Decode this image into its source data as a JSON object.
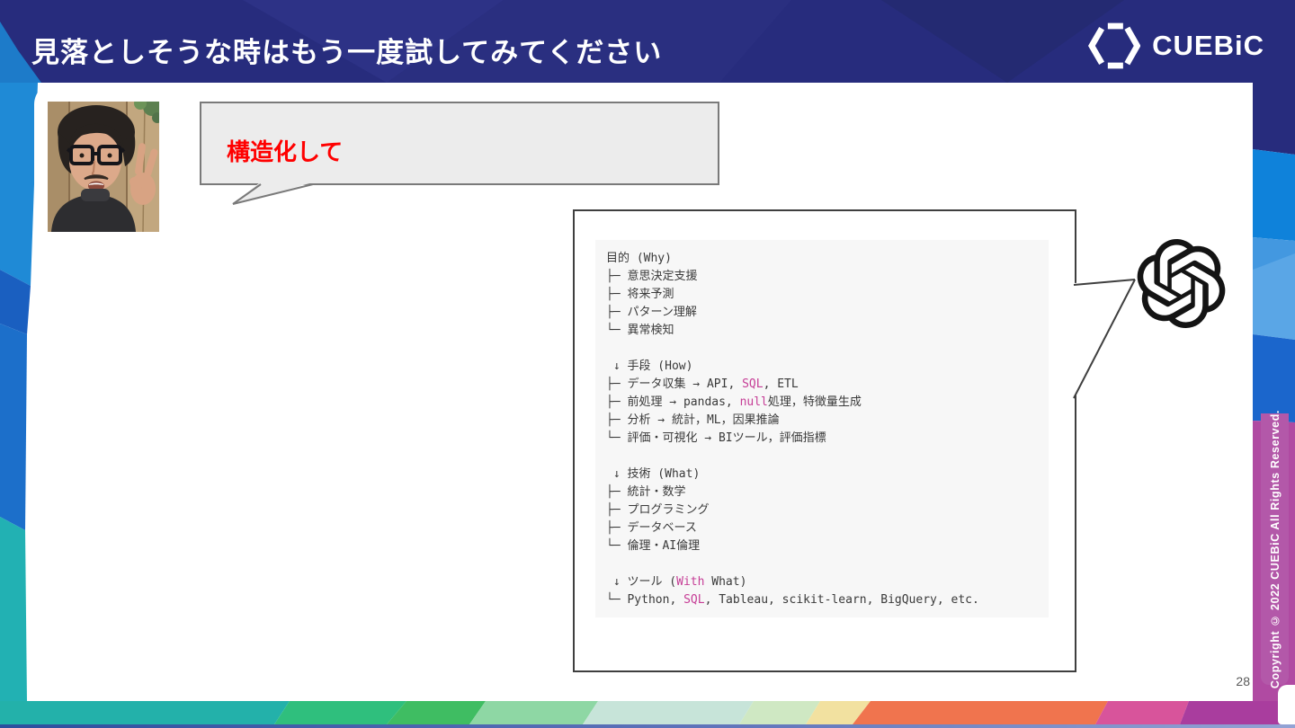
{
  "slide": {
    "title": "見落としそうな時はもう一度試してみてください",
    "page_number": "28",
    "copyright_notice": "Copyright © 2022 CUEBiC All Rights Reserved."
  },
  "brand": {
    "name": "CUEBiC",
    "logo_icon": "cuebic-hexagon-icon",
    "colors": {
      "header_navy": "#272c7d",
      "copyright_tab_pink": "#b358a9",
      "bottom_band": [
        "#23b1aa",
        "#2fbf7d",
        "#3fbd62",
        "#8ed7a4",
        "#c7e4d9",
        "#cfe8c3",
        "#f2e1a0",
        "#f0744e",
        "#d8549b",
        "#a93d9e"
      ]
    }
  },
  "speaker": {
    "photo": "man-with-glasses-peace-sign-photo",
    "bubble_text": "構造化して",
    "bubble_text_color": "#ff0000"
  },
  "chatgpt": {
    "logo": "openai-icon",
    "panel_bg": "#f7f7f7",
    "highlight_color": "#c63d96",
    "lines": [
      {
        "segments": [
          {
            "text": "目的 (Why)"
          }
        ]
      },
      {
        "segments": [
          {
            "text": "├─ 意思決定支援"
          }
        ]
      },
      {
        "segments": [
          {
            "text": "├─ 将来予測"
          }
        ]
      },
      {
        "segments": [
          {
            "text": "├─ パターン理解"
          }
        ]
      },
      {
        "segments": [
          {
            "text": "└─ 異常検知"
          }
        ]
      },
      {
        "segments": []
      },
      {
        "segments": [
          {
            "text": " ↓ 手段 (How)"
          }
        ]
      },
      {
        "segments": [
          {
            "text": "├─ データ収集 → API, "
          },
          {
            "text": "SQL",
            "highlight": true
          },
          {
            "text": ", ETL"
          }
        ]
      },
      {
        "segments": [
          {
            "text": "├─ 前処理 → pandas, "
          },
          {
            "text": "null",
            "highlight": true
          },
          {
            "text": "処理，特徴量生成"
          }
        ]
      },
      {
        "segments": [
          {
            "text": "├─ 分析 → 統計，ML，因果推論"
          }
        ]
      },
      {
        "segments": [
          {
            "text": "└─ 評価・可視化 → BIツール，評価指標"
          }
        ]
      },
      {
        "segments": []
      },
      {
        "segments": [
          {
            "text": " ↓ 技術 (What)"
          }
        ]
      },
      {
        "segments": [
          {
            "text": "├─ 統計・数学"
          }
        ]
      },
      {
        "segments": [
          {
            "text": "├─ プログラミング"
          }
        ]
      },
      {
        "segments": [
          {
            "text": "├─ データベース"
          }
        ]
      },
      {
        "segments": [
          {
            "text": "└─ 倫理・AI倫理"
          }
        ]
      },
      {
        "segments": []
      },
      {
        "segments": [
          {
            "text": " ↓ ツール ("
          },
          {
            "text": "With",
            "highlight": true
          },
          {
            "text": " What)"
          }
        ]
      },
      {
        "segments": [
          {
            "text": "└─ Python, "
          },
          {
            "text": "SQL",
            "highlight": true
          },
          {
            "text": ", Tableau, scikit-learn, BigQuery, etc."
          }
        ]
      }
    ]
  }
}
